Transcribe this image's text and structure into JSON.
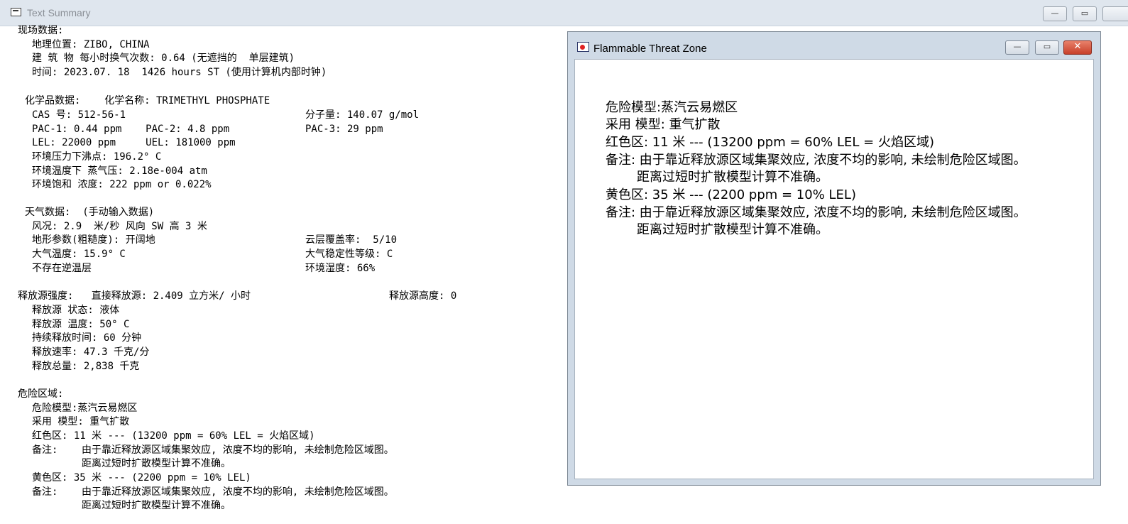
{
  "window": {
    "title": "Text Summary",
    "minimize_glyph": "—",
    "maximize_glyph": "▭"
  },
  "summary": {
    "site_header": "现场数据:",
    "location": "地理位置: ZIBO, CHINA",
    "building": "建 筑 物 每小时换气次数: 0.64 (无遮挡的  单层建筑)",
    "time": "时间: 2023.07. 18  1426 hours ST (使用计算机内部时钟)",
    "chem_header": "化学品数据:    化学名称: TRIMETHYL PHOSPHATE",
    "cas": "CAS 号: 512-56-1",
    "molweight": "分子量: 140.07 g/mol",
    "pac12": "PAC-1: 0.44 ppm    PAC-2: 4.8 ppm",
    "pac3": "PAC-3: 29 ppm",
    "lel": "LEL: 22000 ppm     UEL: 181000 ppm",
    "boiling": "环境压力下沸点: 196.2° C",
    "vapor": "环境温度下 蒸气压: 2.18e-004 atm",
    "saturation": "环境饱和 浓度: 222 ppm or 0.022%",
    "weather_header": "天气数据:  (手动输入数据)",
    "wind": "风况: 2.9  米/秒 风向 SW 高 3 米",
    "terrain": "地形参数(粗糙度): 开阔地",
    "cloud": "云层覆盖率:  5/10",
    "air_temp": "大气温度: 15.9° C",
    "stability": "大气稳定性等级: C",
    "inversion": "不存在逆温层",
    "humidity": "环境湿度: 66%",
    "source_header": "释放源强度:   直接释放源: 2.409 立方米/ 小时",
    "source_height": "释放源高度: 0",
    "source_state": "释放源 状态: 液体",
    "source_temp": "释放源 温度: 50° C",
    "duration": "持续释放时间: 60 分钟",
    "rate": "释放速率: 47.3 千克/分",
    "total": "释放总量: 2,838 千克",
    "threat_header": "危险区域:",
    "threat_model": "危险模型:蒸汽云易燃区",
    "model": "采用 模型: 重气扩散",
    "red": "红色区: 11 米 --- (13200 ppm = 60% LEL = 火焰区域)",
    "note_label_1": "备注:",
    "note1": "由于靠近释放源区域集聚效应, 浓度不均的影响, 未绘制危险区域图。",
    "note1b": "距离过短时扩散模型计算不准确。",
    "yellow": "黄色区: 35 米 --- (2200 ppm = 10% LEL)",
    "note_label_2": "备注:",
    "note2": "由于靠近释放源区域集聚效应, 浓度不均的影响, 未绘制危险区域图。",
    "note2b": "距离过短时扩散模型计算不准确。"
  },
  "child_window": {
    "title": "Flammable Threat Zone",
    "minimize_glyph": "—",
    "maximize_glyph": "▭",
    "close_glyph": "✕",
    "lines": {
      "threat_model": "危险模型:蒸汽云易燃区",
      "model": "采用 模型: 重气扩散",
      "red": "红色区: 11 米 --- (13200 ppm = 60% LEL = 火焰区域)",
      "note1": "备注: 由于靠近释放源区域集聚效应, 浓度不均的影响, 未绘制危险区域图。",
      "note1b": "距离过短时扩散模型计算不准确。",
      "yellow": "黄色区: 35 米 --- (2200 ppm = 10% LEL)",
      "note2": "备注: 由于靠近释放源区域集聚效应, 浓度不均的影响, 未绘制危险区域图。",
      "note2b": "距离过短时扩散模型计算不准确。"
    }
  },
  "icons": {
    "app_icon": "text-summary-icon",
    "child_icon": "flammable-zone-icon"
  }
}
